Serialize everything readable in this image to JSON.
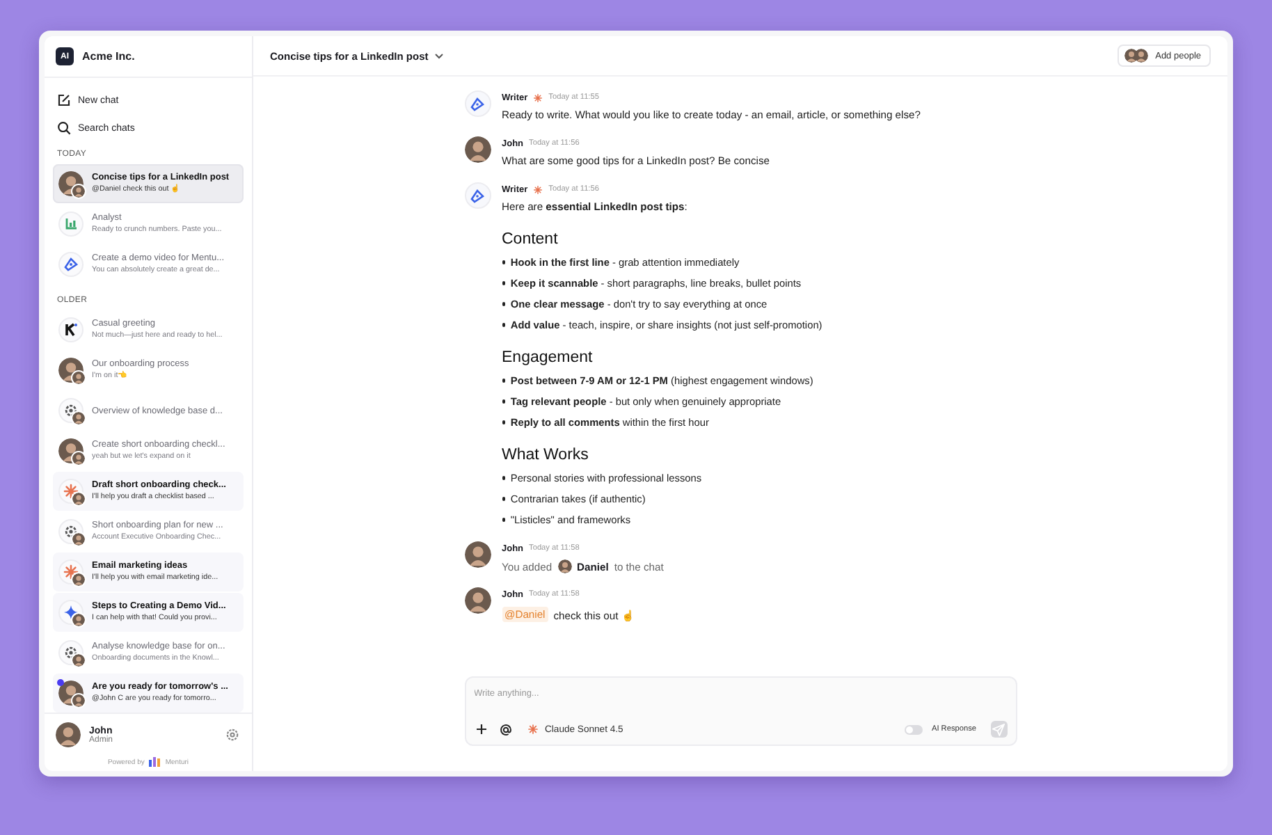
{
  "workspace": {
    "logo": "AI",
    "name": "Acme Inc."
  },
  "sidebar": {
    "actions": [
      {
        "kind": "new",
        "label": "New chat"
      },
      {
        "kind": "search",
        "label": "Search chats"
      }
    ],
    "sections": [
      {
        "label": "TODAY",
        "items": [
          {
            "kind": "person",
            "shared": true,
            "unread": false,
            "notified": false,
            "selected": true,
            "title": "Concise tips for a LinkedIn post",
            "preview": "@Daniel check this out ☝"
          },
          {
            "kind": "analyst",
            "shared": false,
            "unread": false,
            "notified": false,
            "selected": false,
            "title": "Analyst",
            "preview": "Ready to crunch numbers. Paste you..."
          },
          {
            "kind": "writer",
            "shared": false,
            "unread": false,
            "notified": false,
            "selected": false,
            "title": "Create a demo video for Mentu...",
            "preview": "You can absolutely create a great de..."
          }
        ]
      },
      {
        "label": "OLDER",
        "items": [
          {
            "kind": "k-logo",
            "shared": false,
            "unread": false,
            "notified": false,
            "selected": false,
            "title": "Casual greeting",
            "preview": "Not much—just here and ready to hel..."
          },
          {
            "kind": "person",
            "shared": true,
            "unread": false,
            "notified": false,
            "selected": false,
            "title": "Our onboarding process",
            "preview": "I'm on it👈"
          },
          {
            "kind": "gear",
            "shared": true,
            "unread": false,
            "notified": false,
            "selected": false,
            "title": "Overview of knowledge base d..."
          },
          {
            "kind": "person",
            "shared": true,
            "unread": false,
            "notified": false,
            "selected": false,
            "title": "Create short onboarding checkl...",
            "preview": "yeah but we let's expand on it"
          },
          {
            "kind": "claude",
            "shared": true,
            "unread": true,
            "notified": false,
            "selected": false,
            "title": "Draft short onboarding check...",
            "preview": "I'll help you draft a checklist based ..."
          },
          {
            "kind": "gear",
            "shared": true,
            "unread": false,
            "notified": false,
            "selected": false,
            "title": "Short onboarding plan for new ...",
            "preview": "Account Executive Onboarding Chec..."
          },
          {
            "kind": "claude",
            "shared": true,
            "unread": true,
            "notified": false,
            "selected": false,
            "title": "Email marketing ideas",
            "preview": "I'll help you with email marketing ide..."
          },
          {
            "kind": "sparkle",
            "shared": true,
            "unread": true,
            "notified": false,
            "selected": false,
            "title": "Steps to Creating a Demo Vid...",
            "preview": "I can help with that! Could you provi..."
          },
          {
            "kind": "gear",
            "shared": true,
            "unread": false,
            "notified": false,
            "selected": false,
            "title": "Analyse knowledge base for on...",
            "preview": "Onboarding documents in the Knowl..."
          },
          {
            "kind": "person",
            "shared": true,
            "unread": true,
            "notified": true,
            "selected": false,
            "title": "Are you ready for tomorrow's ...",
            "preview": "@John C are you ready for tomorro..."
          }
        ]
      }
    ],
    "user": {
      "name": "John",
      "role": "Admin"
    },
    "powered_by": {
      "label": "Powered by",
      "brand": "Menturi"
    }
  },
  "header": {
    "title": "Concise tips for a LinkedIn post",
    "add_people": "Add people"
  },
  "messages": [
    {
      "kind": "assistant",
      "author": "Writer",
      "time": "Today at 11:55",
      "blocks": [
        {
          "kind": "paragraph",
          "text": "Ready to write. What would you like to create today - an email, article, or something else?"
        }
      ]
    },
    {
      "kind": "user",
      "author": "John",
      "time": "Today at 11:56",
      "blocks": [
        {
          "kind": "paragraph",
          "text": "What are some good tips for a LinkedIn post? Be concise"
        }
      ]
    },
    {
      "kind": "assistant",
      "author": "Writer",
      "time": "Today at 11:56",
      "blocks": [
        {
          "kind": "paragraph",
          "text": "Here are **essential LinkedIn post tips**:"
        },
        {
          "kind": "heading",
          "text": "Content"
        },
        {
          "kind": "bullets",
          "items": [
            "**Hook in the first line** - grab attention immediately",
            "**Keep it scannable** - short paragraphs, line breaks, bullet points",
            "**One clear message** - don't try to say everything at once",
            "**Add value** - teach, inspire, or share insights (not just self-promotion)"
          ]
        },
        {
          "kind": "heading",
          "text": "Engagement"
        },
        {
          "kind": "bullets",
          "items": [
            "**Post between 7-9 AM or 12-1 PM** (highest engagement windows)",
            "**Tag relevant people** - but only when genuinely appropriate",
            "**Reply to all comments** within the first hour"
          ]
        },
        {
          "kind": "heading",
          "text": "What Works"
        },
        {
          "kind": "bullets",
          "items": [
            "Personal stories with professional lessons",
            "Contrarian takes (if authentic)",
            "\"Listicles\" and frameworks"
          ]
        }
      ]
    },
    {
      "kind": "user",
      "author": "John",
      "time": "Today at 11:58",
      "blocks": [
        {
          "kind": "added",
          "text": "You added",
          "name": "Daniel",
          "suffix": "to the chat"
        }
      ]
    },
    {
      "kind": "user",
      "author": "John",
      "time": "Today at 11:58",
      "blocks": [
        {
          "kind": "mention",
          "mention": "@Daniel",
          "text": "check this out ☝"
        }
      ]
    }
  ],
  "composer": {
    "placeholder": "Write anything...",
    "model": "Claude Sonnet 4.5",
    "ai_response": {
      "label": "AI Response",
      "on": false
    },
    "send_disabled": true
  }
}
